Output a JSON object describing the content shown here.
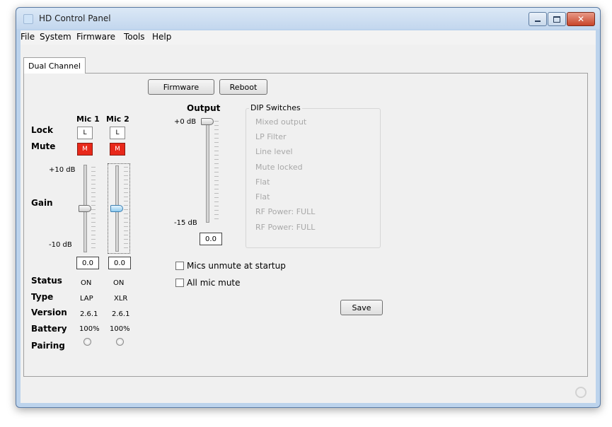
{
  "window": {
    "title": "HD Control Panel"
  },
  "menu": [
    "File",
    "System",
    "Firmware",
    "Tools",
    "Help"
  ],
  "tab": "Dual Channel",
  "buttons": {
    "firmware": "Firmware",
    "reboot": "Reboot",
    "save": "Save"
  },
  "mics": {
    "lock_label": "Lock",
    "mute_label": "Mute",
    "gain_label": "Gain",
    "gain_max": "+10 dB",
    "gain_min": "-10 dB",
    "status_label": "Status",
    "type_label": "Type",
    "version_label": "Version",
    "battery_label": "Battery",
    "pairing_label": "Pairing",
    "channels": [
      {
        "name": "Mic 1",
        "lock": "L",
        "mute": "M",
        "gain_value": "0.0",
        "gain_level": 0.5,
        "status": "ON",
        "type": "LAP",
        "version": "2.6.1",
        "battery": "100%"
      },
      {
        "name": "Mic 2",
        "lock": "L",
        "mute": "M",
        "gain_value": "0.0",
        "gain_level": 0.5,
        "status": "ON",
        "type": "XLR",
        "version": "2.6.1",
        "battery": "100%"
      }
    ]
  },
  "output": {
    "label": "Output",
    "max": "+0 dB",
    "min": "-15 dB",
    "value": "0.0",
    "level": 1.0
  },
  "dip": {
    "title": "DIP Switches",
    "items": [
      "Mixed output",
      "LP Filter",
      "Line level",
      "Mute locked",
      "Flat",
      "Flat",
      "RF Power: FULL",
      "RF Power: FULL"
    ]
  },
  "checkboxes": {
    "unmute_startup": "Mics unmute at startup",
    "all_mute": "All mic mute"
  },
  "colors": {
    "mute": "#e8281a",
    "active_thumb": "#8ecbf0"
  }
}
